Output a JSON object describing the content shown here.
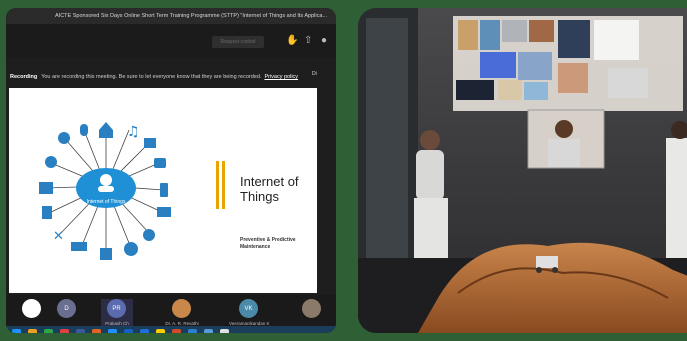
{
  "left_panel": {
    "window_title": "AICTE Sponsored Six Days Online Short Term Training Programme (STTP) \"Internet of Things and Its Applica...",
    "toolbar_button_label": "Request control",
    "recording_bar": {
      "bold_text": "Recording",
      "message": "You are recording this meeting. Be sure to let everyone know that they are being recorded.",
      "link": "Privacy policy",
      "dismiss": "Di"
    },
    "slide": {
      "center_label": "Internet of Things",
      "title": "Internet of Things",
      "subtitle": "Preventive & Predictive Maintenance"
    },
    "participants": [
      {
        "initials": "",
        "name": "",
        "color": "#ffffff"
      },
      {
        "initials": "D",
        "name": "",
        "color": "#6a6f8f"
      },
      {
        "initials": "PR",
        "name": "Prakash Ch",
        "color": "#5b6bb0"
      },
      {
        "initials": "",
        "name": "Dr. A. R. Revathi",
        "color": "#c9874a"
      },
      {
        "initials": "VK",
        "name": "Veeramanikandan K",
        "color": "#4a8aa8"
      },
      {
        "initials": "",
        "name": "",
        "color": "#8a7a6a"
      }
    ],
    "taskbar_icon_colors": [
      "#1e90ff",
      "#f0a020",
      "#2aa84a",
      "#e04040",
      "#3b5998",
      "#e86020",
      "#1e90ff",
      "#1560c0",
      "#1e6fd9",
      "#ffcc00",
      "#d04a2a",
      "#2a7fd0",
      "#5b9bd5",
      "#e0e0e0"
    ],
    "accent_color": "#e8a400",
    "cloud_color": "#1f8fd6"
  },
  "right_panel": {
    "scene": "mixed-reality"
  }
}
